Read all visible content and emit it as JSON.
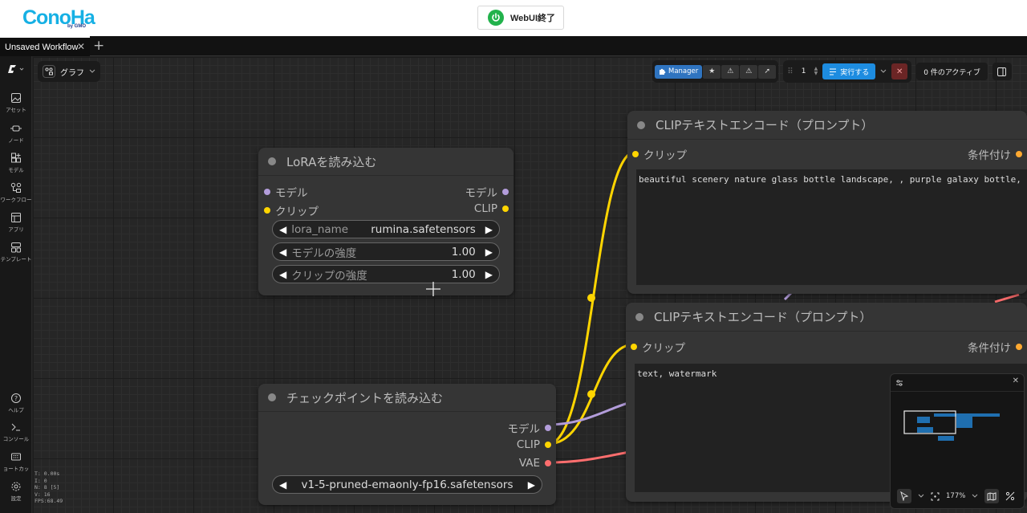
{
  "topbar": {
    "logo_text": "ConoHa",
    "logo_sub": "by GMO",
    "webui_button": "WebUI終了",
    "colors": {
      "logo": "#16b0e4",
      "power": "#22b24c"
    }
  },
  "tabs": {
    "workflow_tab": "Unsaved Workflow",
    "close_glyph": "✕",
    "add_glyph": "+"
  },
  "sidebar": {
    "items": [
      {
        "icon": "image-icon",
        "label": "アセット"
      },
      {
        "icon": "node-icon",
        "label": "ノード"
      },
      {
        "icon": "model-icon",
        "label": "モデル"
      },
      {
        "icon": "workflow-icon",
        "label": "ワークフロー"
      },
      {
        "icon": "app-icon",
        "label": "アプリ"
      },
      {
        "icon": "template-icon",
        "label": "テンプレート"
      }
    ],
    "bottom": [
      {
        "icon": "help-icon",
        "label": "ヘルプ"
      },
      {
        "icon": "console-icon",
        "label": "コンソール"
      },
      {
        "icon": "keyboard-icon",
        "label": "ョートカッ"
      },
      {
        "icon": "gear-icon",
        "label": "設定"
      }
    ],
    "stats": [
      "T: 0.00s",
      "I: 0",
      "N: 8 [5]",
      "V: 16",
      "FPS:68.49"
    ]
  },
  "graph_menu": {
    "label": "グラフ"
  },
  "toolbar": {
    "manager": "Manager",
    "queue_count": "1",
    "run": "実行する",
    "active": "0 件のアクティブ",
    "colors": {
      "run": "#1d8ce0",
      "manager": "#2f74c0"
    }
  },
  "nodes": {
    "lora": {
      "title": "LoRAを読み込む",
      "in_model": "モデル",
      "in_clip": "クリップ",
      "out_model": "モデル",
      "out_clip": "CLIP",
      "w1_label": "lora_name",
      "w1_value": "rumina.safetensors",
      "w2_label": "モデルの強度",
      "w2_value": "1.00",
      "w3_label": "クリップの強度",
      "w3_value": "1.00"
    },
    "checkpoint": {
      "title": "チェックポイントを読み込む",
      "out_model": "モデル",
      "out_clip": "CLIP",
      "out_vae": "VAE",
      "ckpt": "v1-5-pruned-emaonly-fp16.safetensors"
    },
    "clip_pos": {
      "title": "CLIPテキストエンコード（プロンプト）",
      "in_clip": "クリップ",
      "out_cond": "条件付け",
      "text": "beautiful scenery nature glass bottle landscape, , purple galaxy bottle,"
    },
    "clip_neg": {
      "title": "CLIPテキストエンコード（プロンプト）",
      "in_clip": "クリップ",
      "out_cond": "条件付け",
      "text": "text, watermark"
    }
  },
  "slot_colors": {
    "model": "#b39ddb",
    "clip": "#ffd500",
    "vae": "#ff6e6e",
    "cond": "#ffa931"
  },
  "minimap": {
    "zoom": "177%"
  }
}
